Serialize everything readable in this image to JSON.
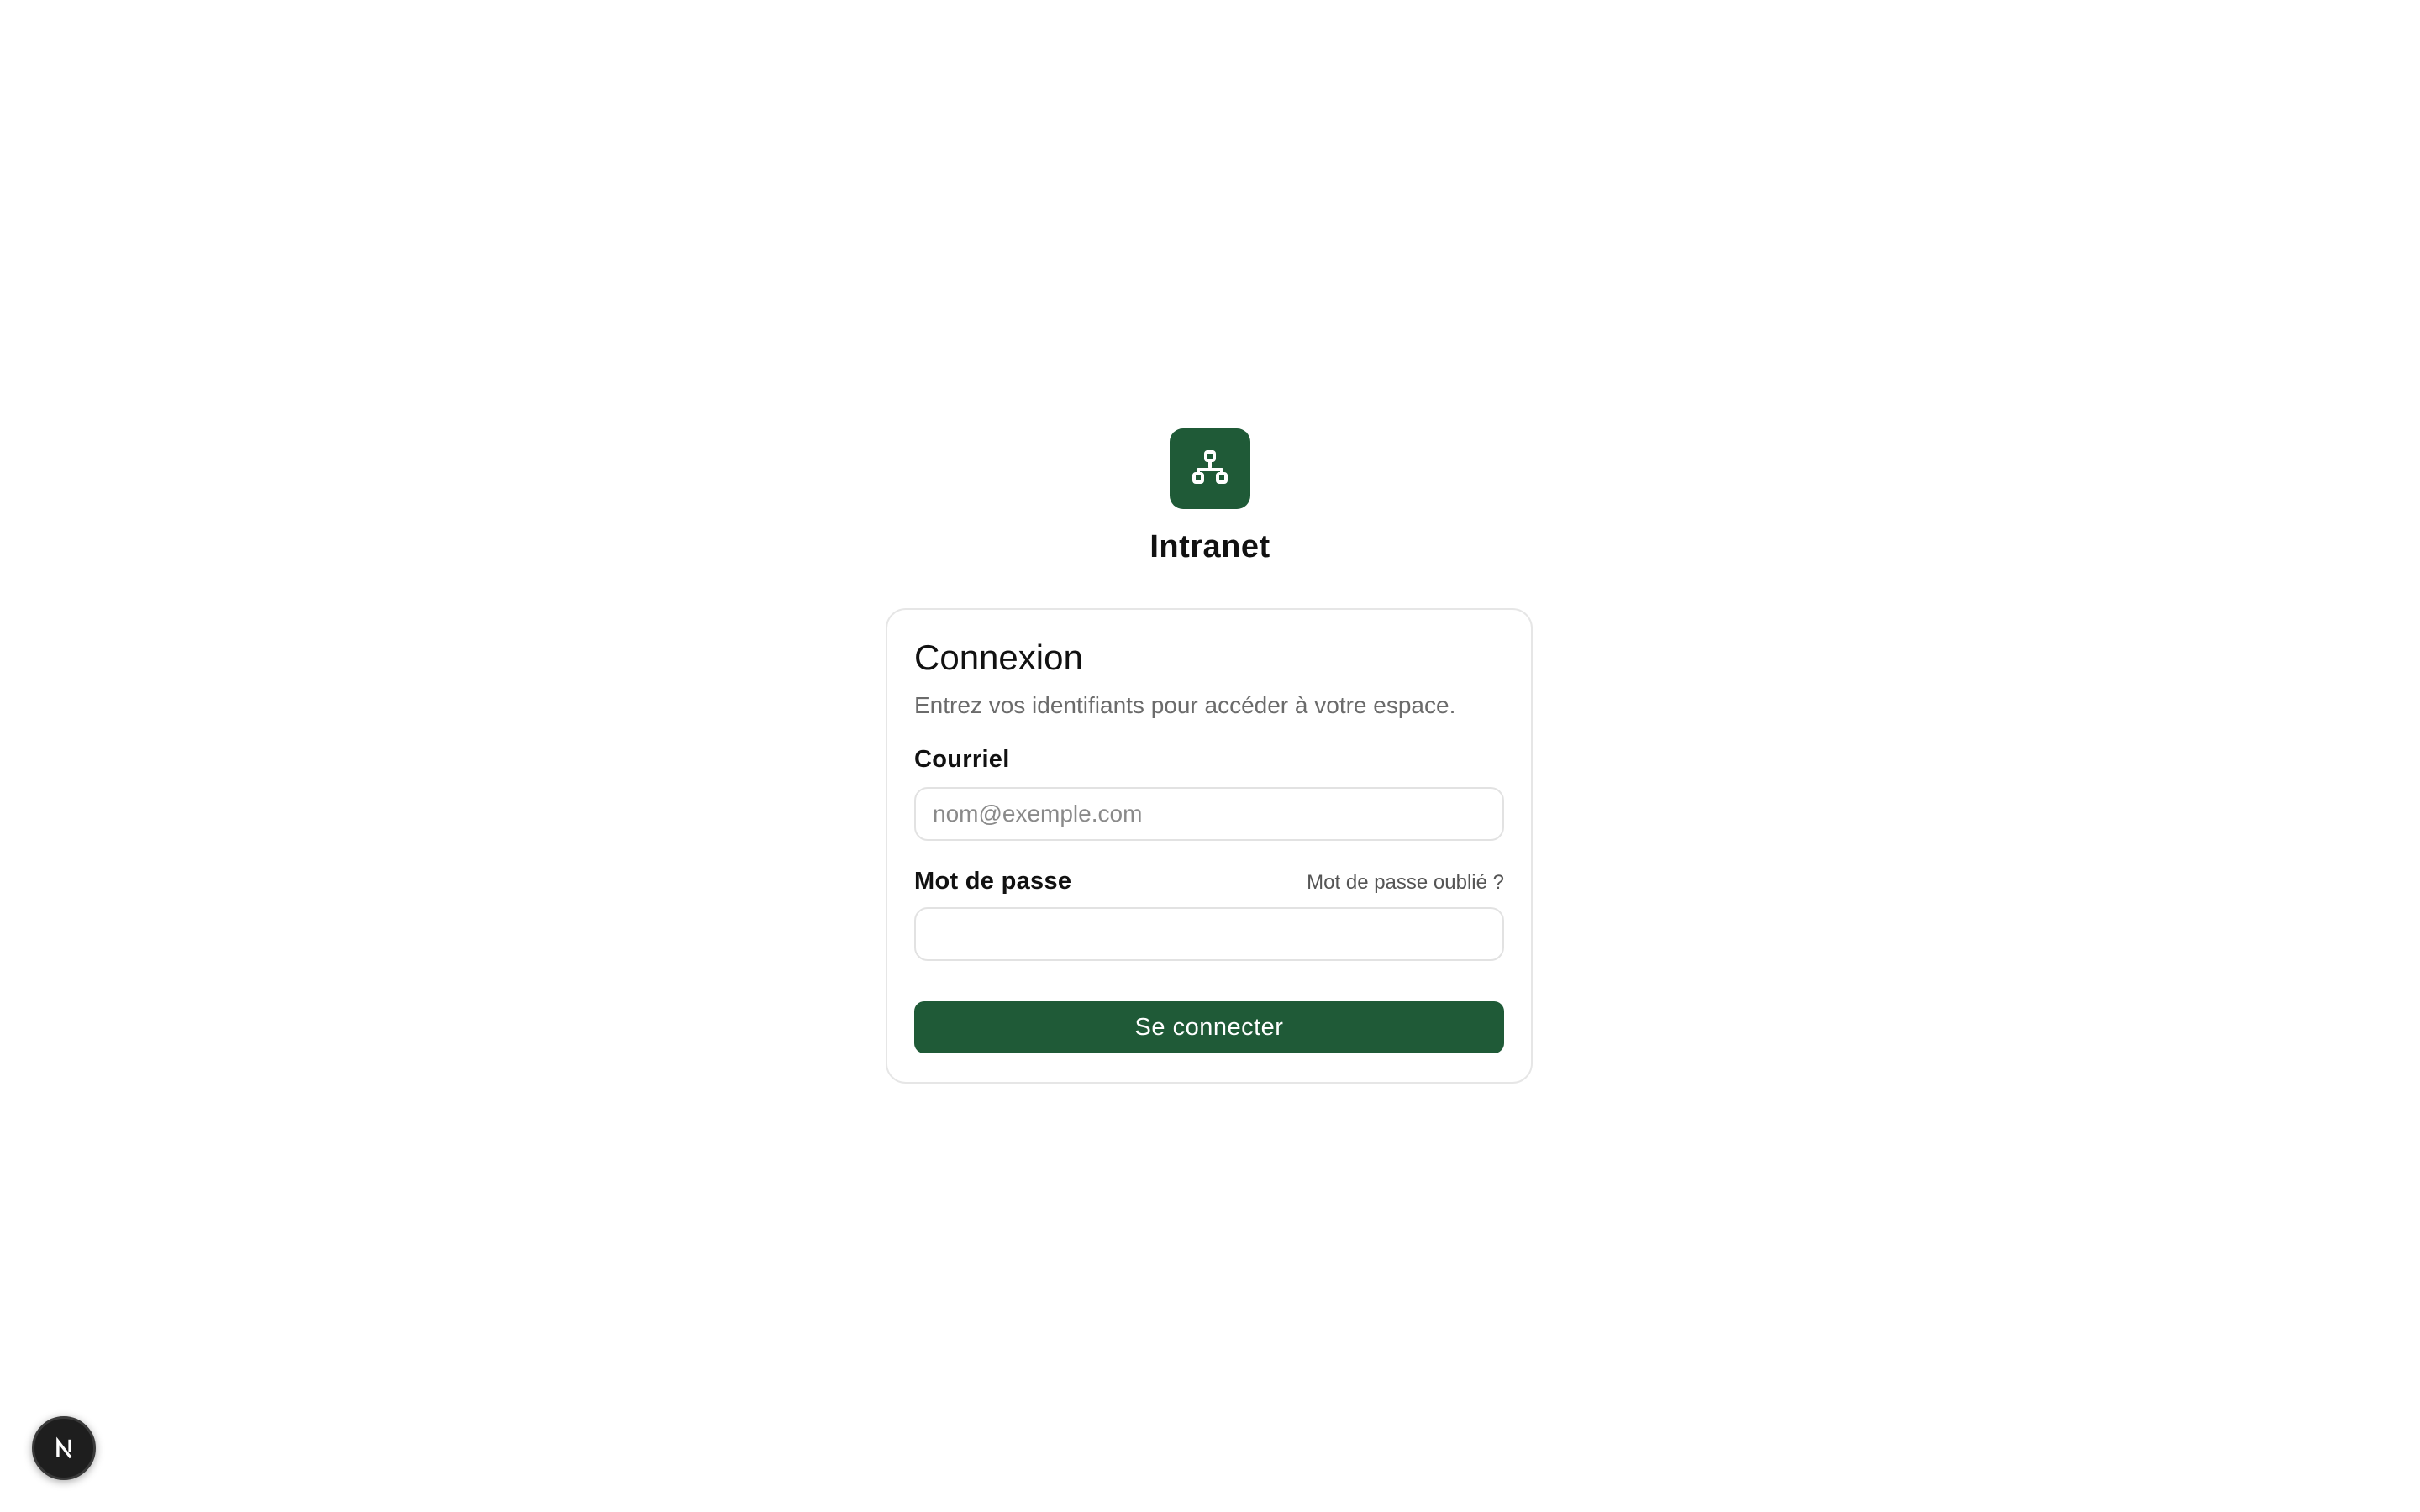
{
  "app": {
    "name": "Intranet",
    "logo_icon": "sitemap-icon",
    "accent_color": "#1f5a37"
  },
  "login": {
    "title": "Connexion",
    "subtitle": "Entrez vos identifiants pour accéder à votre espace.",
    "email": {
      "label": "Courriel",
      "placeholder": "nom@exemple.com",
      "value": ""
    },
    "password": {
      "label": "Mot de passe",
      "forgot_label": "Mot de passe oublié ?",
      "value": ""
    },
    "submit_label": "Se connecter"
  },
  "dev_badge": {
    "icon": "nextjs-logo-icon"
  }
}
